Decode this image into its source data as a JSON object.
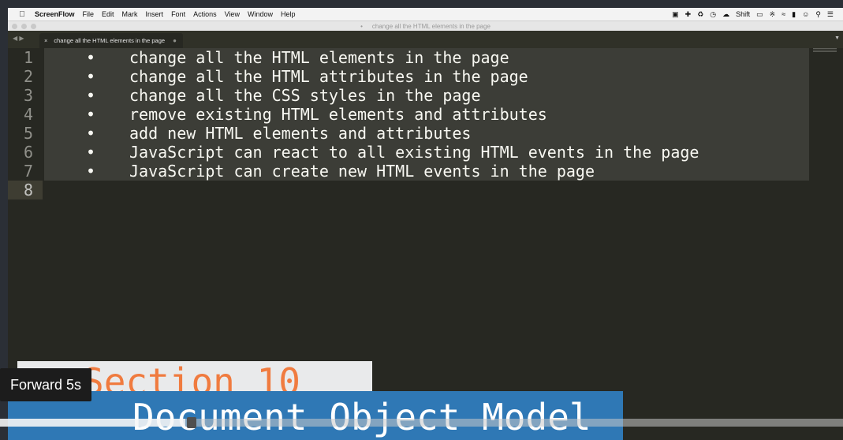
{
  "menubar": {
    "app": "ScreenFlow",
    "items": [
      "File",
      "Edit",
      "Mark",
      "Insert",
      "Font",
      "Actions",
      "View",
      "Window",
      "Help"
    ],
    "status": {
      "shift": "Shift"
    }
  },
  "window": {
    "title": "change all the HTML elements in the page"
  },
  "tab": {
    "label": "change all the HTML elements in the page"
  },
  "editor": {
    "line_numbers": [
      "1",
      "2",
      "3",
      "4",
      "5",
      "6",
      "7",
      "8"
    ],
    "bullet": "•",
    "lines": [
      "change all the HTML elements in the page",
      "change all the HTML attributes in the page",
      "change all the CSS styles in the page",
      "remove existing HTML elements and attributes",
      "add new HTML elements and attributes",
      "JavaScript can react to all existing HTML events in the page",
      "JavaScript can create new HTML events in the page",
      ""
    ]
  },
  "overlay": {
    "section": "Section 10",
    "topic": "Document Object Model",
    "tooltip": "Forward 5s"
  },
  "player": {
    "progress_fraction": 0.22
  }
}
